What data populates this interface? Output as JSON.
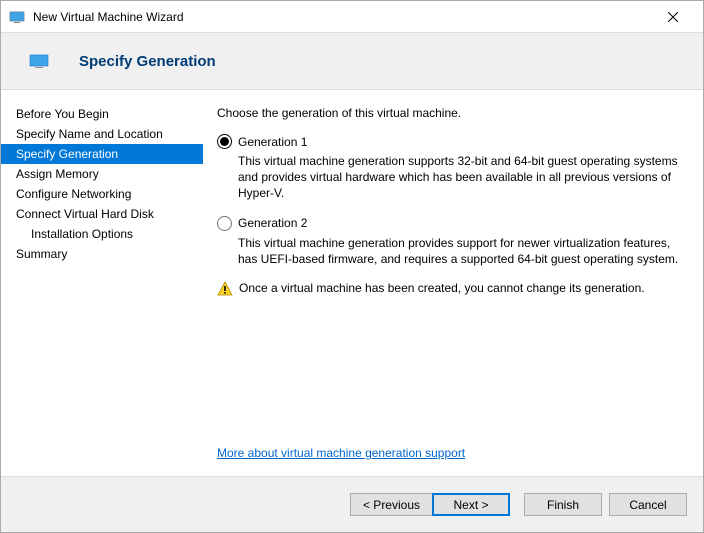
{
  "titlebar": {
    "title": "New Virtual Machine Wizard"
  },
  "header": {
    "title": "Specify Generation"
  },
  "sidebar": {
    "items": [
      {
        "label": "Before You Begin"
      },
      {
        "label": "Specify Name and Location"
      },
      {
        "label": "Specify Generation"
      },
      {
        "label": "Assign Memory"
      },
      {
        "label": "Configure Networking"
      },
      {
        "label": "Connect Virtual Hard Disk"
      },
      {
        "label": "Installation Options"
      },
      {
        "label": "Summary"
      }
    ]
  },
  "content": {
    "instruction": "Choose the generation of this virtual machine.",
    "options": [
      {
        "label": "Generation 1",
        "description": "This virtual machine generation supports 32-bit and 64-bit guest operating systems and provides virtual hardware which has been available in all previous versions of Hyper-V."
      },
      {
        "label": "Generation 2",
        "description": "This virtual machine generation provides support for newer virtualization features, has UEFI-based firmware, and requires a supported 64-bit guest operating system."
      }
    ],
    "warning": "Once a virtual machine has been created, you cannot change its generation.",
    "link": "More about virtual machine generation support"
  },
  "footer": {
    "previous": "< Previous",
    "next": "Next >",
    "finish": "Finish",
    "cancel": "Cancel"
  }
}
